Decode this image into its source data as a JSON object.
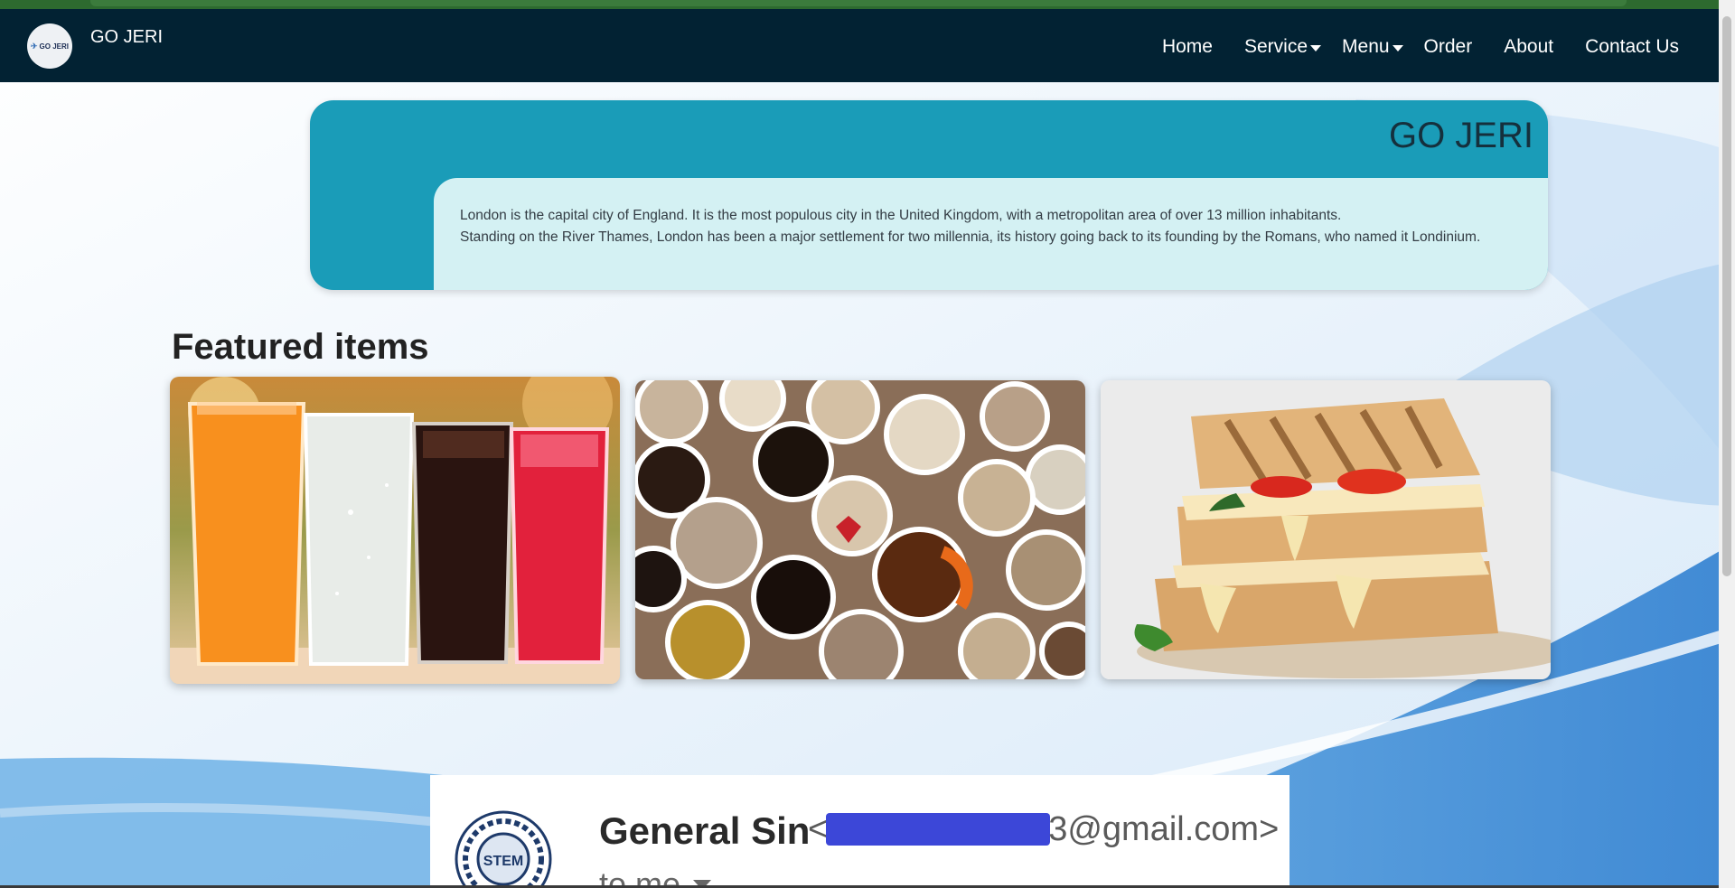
{
  "navbar": {
    "logo_text": "GO JERI",
    "brand": "GO JERI",
    "links": [
      {
        "label": "Home"
      },
      {
        "label": "Service"
      },
      {
        "label": "Menu"
      },
      {
        "label": "Order"
      },
      {
        "label": "About"
      },
      {
        "label": "Contact Us"
      }
    ]
  },
  "hero": {
    "title": "GO JERI",
    "line1": "London is the capital city of England. It is the most populous city in the United Kingdom, with a metropolitan area of over 13 million inhabitants.",
    "line2": "Standing on the River Thames, London has been a major settlement for two millennia, its history going back to its founding by the Romans, who named it Londinium."
  },
  "featured": {
    "title": "Featured items",
    "items": [
      {
        "image": "drinks-image"
      },
      {
        "image": "coffee-cups-image"
      },
      {
        "image": "sandwich-image"
      }
    ]
  },
  "email": {
    "sender": "General Sin",
    "address_prefix": "<",
    "address_suffix": "3@gmail.com>",
    "to": "to me",
    "avatar_text": "STEM"
  },
  "colors": {
    "navbar": "#022233",
    "hero": "#1a9cb8",
    "hero_text_bg": "#d4f1f3",
    "top_strip": "#2d6a2f"
  }
}
